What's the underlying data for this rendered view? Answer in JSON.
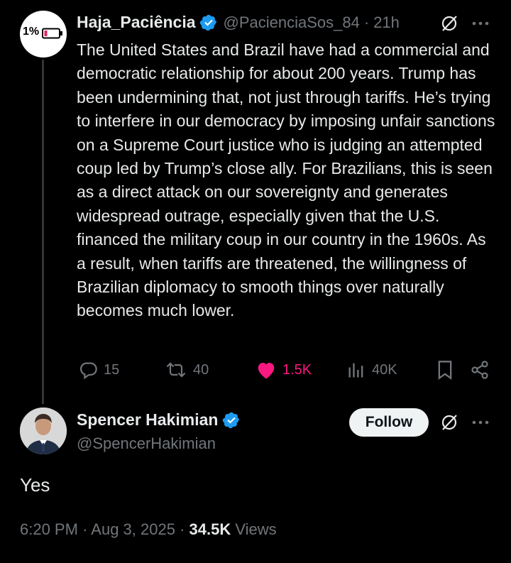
{
  "reply_parent": {
    "display_name": "Haja_Paciência",
    "handle": "@PacienciaSos_84",
    "separator": "·",
    "time": "21h",
    "avatar_text": "1%",
    "text": "The United States and Brazil have had a commercial and democratic relationship for about 200 years. Trump has been undermining that, not just through tariffs. He’s trying to interfere in our democracy by imposing unfair sanctions on a Supreme Court justice who is judging an attempted coup led by Trump’s close ally. For Brazilians, this is seen as a direct attack on our sovereignty and generates widespread outrage, especially given that the U.S. financed the military coup in our country in the 1960s. As a result, when tariffs are threatened, the willingness of Brazilian diplomacy to smooth things over naturally becomes much lower.",
    "actions": {
      "replies": "15",
      "reposts": "40",
      "likes": "1.5K",
      "views": "40K"
    }
  },
  "main_tweet": {
    "display_name": "Spencer Hakimian",
    "handle": "@SpencerHakimian",
    "follow_label": "Follow",
    "text": "Yes",
    "time": "6:20 PM",
    "date": "Aug 3, 2025",
    "views_count": "34.5K",
    "views_label": "Views",
    "separator": "·"
  },
  "colors": {
    "background": "#000000",
    "text": "#e7e9ea",
    "muted": "#71767b",
    "verified": "#1d9bf0",
    "like": "#f91880",
    "battery_red": "#e0245e"
  },
  "icons": [
    "verified-badge-icon",
    "grok-icon",
    "more-icon",
    "reply-icon",
    "repost-icon",
    "like-icon",
    "views-icon",
    "bookmark-icon",
    "share-icon"
  ]
}
